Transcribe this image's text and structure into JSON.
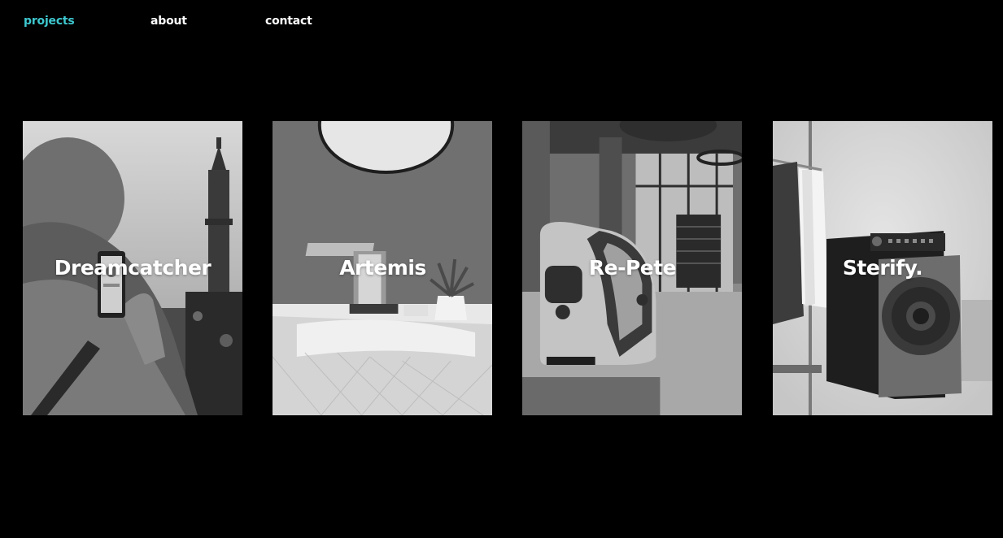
{
  "nav": {
    "projects": "projects",
    "about": "about",
    "contact": "contact",
    "active_color": "#3ec8d0"
  },
  "projects": [
    {
      "title": "Dreamcatcher",
      "image": "woman-photographing-tower-with-phone"
    },
    {
      "title": "Artemis",
      "image": "bathroom-sink-faucet-with-mirror-and-plant"
    },
    {
      "title": "Re-Pete",
      "image": "curved-metal-kiosk-in-lobby"
    },
    {
      "title": "Sterify.",
      "image": "wardrobe-sterilizer-appliance-with-clothes"
    }
  ]
}
